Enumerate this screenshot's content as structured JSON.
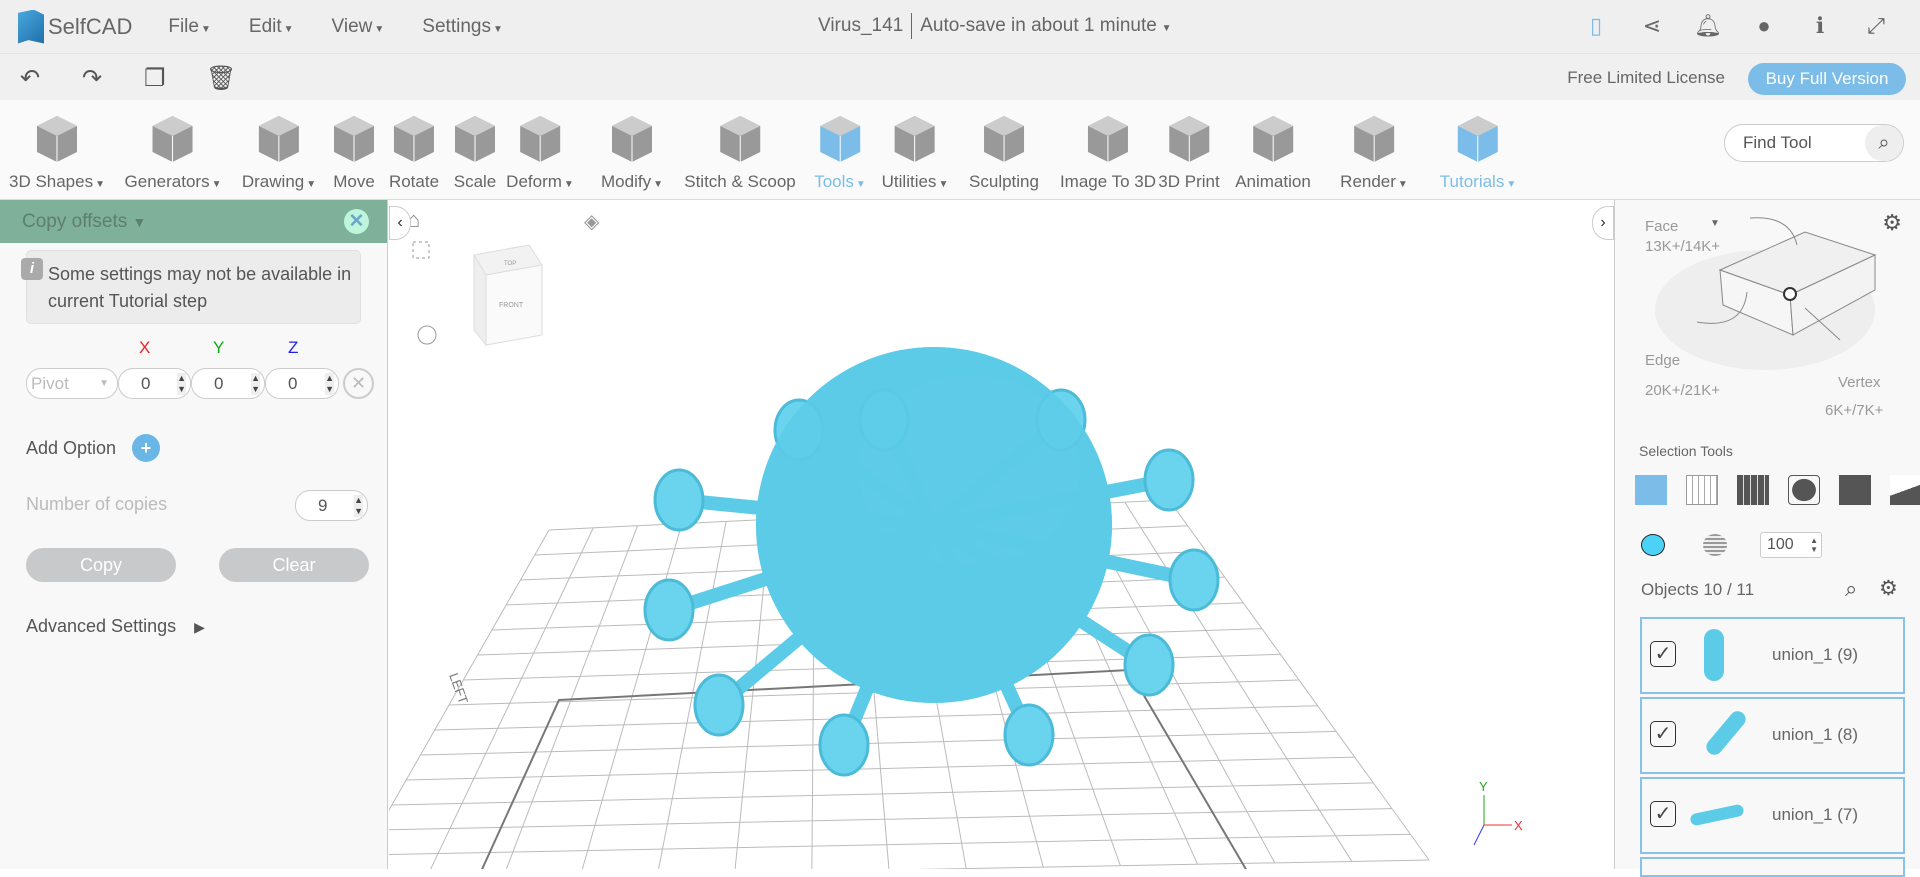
{
  "app": {
    "name": "SelfCAD",
    "file_name": "Virus_141",
    "autosave": "Auto-save in about 1 minute"
  },
  "menu": [
    "File",
    "Edit",
    "View",
    "Settings"
  ],
  "license": {
    "text": "Free Limited License",
    "buy": "Buy Full Version"
  },
  "tools": [
    {
      "label": "3D Shapes",
      "dd": true
    },
    {
      "label": "Generators",
      "dd": true
    },
    {
      "label": "Drawing",
      "dd": true
    },
    {
      "label": "Move"
    },
    {
      "label": "Rotate"
    },
    {
      "label": "Scale"
    },
    {
      "label": "Deform",
      "dd": true
    },
    {
      "label": "Modify",
      "dd": true
    },
    {
      "label": "Stitch & Scoop"
    },
    {
      "label": "Tools",
      "dd": true,
      "active": true
    },
    {
      "label": "Utilities",
      "dd": true
    },
    {
      "label": "Sculpting"
    },
    {
      "label": "Image To 3D"
    },
    {
      "label": "3D Print"
    },
    {
      "label": "Animation"
    },
    {
      "label": "Render",
      "dd": true
    },
    {
      "label": "Tutorials",
      "dd": true,
      "active": true
    }
  ],
  "find_tool": "Find Tool",
  "panel": {
    "title": "Copy offsets",
    "info": "Some settings may not be available in current Tutorial step",
    "axes": [
      "X",
      "Y",
      "Z"
    ],
    "pivot": "Pivot",
    "values": [
      "0",
      "0",
      "0"
    ],
    "add_option": "Add Option",
    "copies_label": "Number of copies",
    "copies": "9",
    "copy": "Copy",
    "clear": "Clear",
    "advanced": "Advanced Settings"
  },
  "viewport": {
    "cube_top": "TOP",
    "cube_front": "FRONT",
    "left_label": "LEFT",
    "axis_x": "X",
    "axis_y": "Y"
  },
  "selection": {
    "face": "Face",
    "face_count": "13K+/14K+",
    "edge": "Edge",
    "edge_count": "20K+/21K+",
    "vertex": "Vertex",
    "vertex_count": "6K+/7K+",
    "tools_label": "Selection Tools",
    "opacity": "100"
  },
  "objects": {
    "label": "Objects 10 / 11",
    "items": [
      "union_1 (9)",
      "union_1 (8)",
      "union_1 (7)"
    ]
  },
  "colors": {
    "accent": "#7bbde8",
    "object": "#5ccbe8",
    "panel_head": "#7fb09a"
  }
}
